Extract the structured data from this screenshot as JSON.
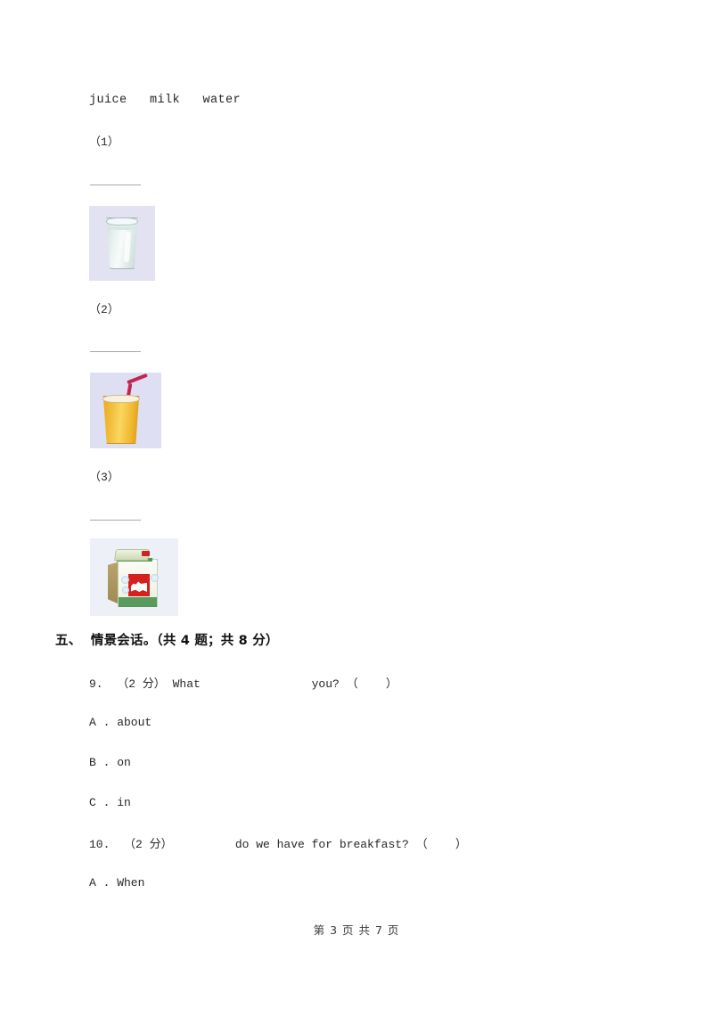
{
  "document": {
    "word_bank": "juice   milk   water",
    "items": [
      {
        "label": "（1）",
        "image": "glass-of-water-image",
        "image_alt": "glass of water"
      },
      {
        "label": "（2）",
        "image": "glass-of-orange-juice-image",
        "image_alt": "glass of orange juice with straw"
      },
      {
        "label": "（3）",
        "image": "milk-carton-image",
        "image_alt": "carton of milk"
      }
    ],
    "section": {
      "number": "五、",
      "title": "情景会话。",
      "meta": "（共 4 题；共 8 分）",
      "full": "五、  情景会话。（共 4 题；共 8 分）"
    },
    "questions": [
      {
        "number": "9.",
        "score": "（2 分）",
        "stem": "What                you? （    ）",
        "full": "9.  （2 分） What                you? （    ）",
        "options": [
          "A . about",
          "B . on",
          "C . in"
        ]
      },
      {
        "number": "10.",
        "score": "（2 分）",
        "stem": "         do we have for breakfast? （    ）",
        "full": "10.  （2 分）         do we have for breakfast? （    ）",
        "options": [
          "A . When"
        ]
      }
    ],
    "footer": "第 3 页 共 7 页"
  },
  "colors": {
    "page_background": "#ffffff",
    "text": "#282828",
    "rule": "#a8a8a8",
    "tile_water_bg": "#e2e2f2",
    "tile_juice_bg": "#dfdff4",
    "tile_milk_bg": "#eef0f7",
    "juice_fill": "#f2bf3b",
    "straw": "#c1264e",
    "milk_green": "#4e9a52",
    "milk_red": "#d61f1f"
  }
}
